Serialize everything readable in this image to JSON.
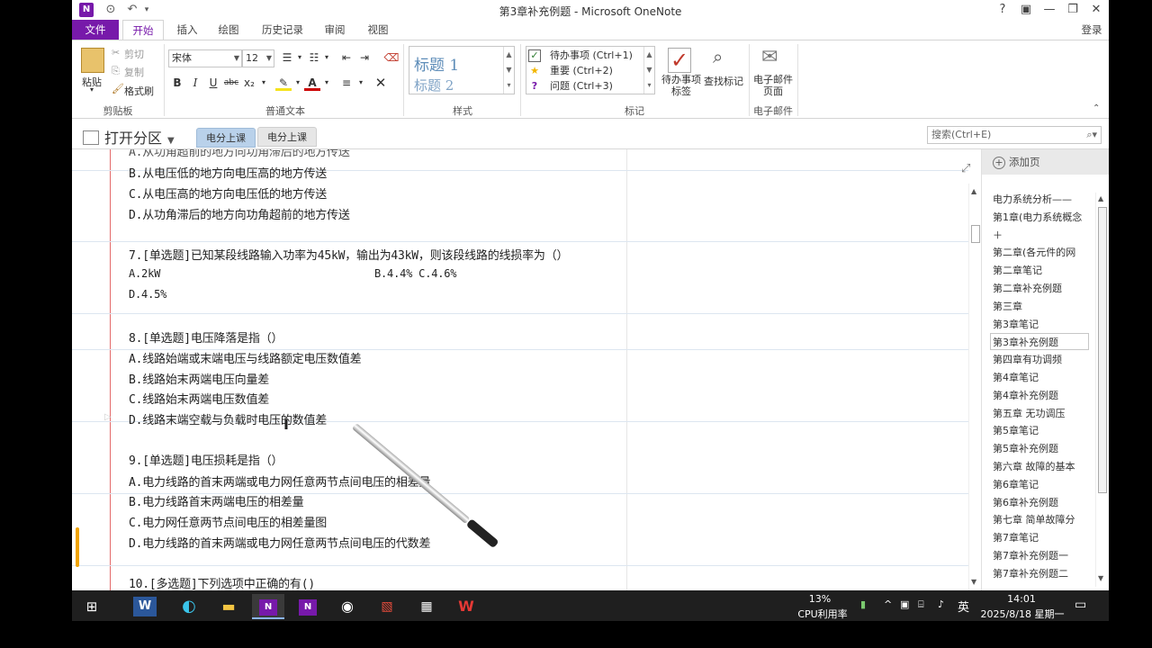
{
  "window": {
    "title": "第3章补充例题 - Microsoft OneNote",
    "help": "?",
    "login": "登录"
  },
  "ribbon_tabs": [
    "文件",
    "开始",
    "插入",
    "绘图",
    "历史记录",
    "审阅",
    "视图"
  ],
  "clipboard": {
    "paste": "粘贴",
    "cut": "剪切",
    "copy": "复制",
    "format_painter": "格式刷",
    "label": "剪贴板"
  },
  "basic_text": {
    "font": "宋体",
    "size": "12",
    "label": "普通文本"
  },
  "styles": {
    "heading1": "标题 1",
    "heading2": "标题 2",
    "label": "样式"
  },
  "tags": {
    "items": [
      {
        "label": "待办事项 (Ctrl+1)",
        "color": "#2e7d32"
      },
      {
        "label": "重要 (Ctrl+2)",
        "color": "#f2b600"
      },
      {
        "label": "问题 (Ctrl+3)",
        "color": "#7719aa"
      }
    ],
    "todo_tag": "待办事项标签",
    "find_tags": "查找标记",
    "label": "标记"
  },
  "email": {
    "button": "电子邮件页面",
    "label": "电子邮件"
  },
  "nav": {
    "notebook": "打开分区",
    "sections": [
      "电分上课",
      "电分上课"
    ],
    "search_placeholder": "搜索(Ctrl+E)"
  },
  "note_lines": [
    "B.从电压低的地方向电压高的地方传送",
    "C.从电压高的地方向电压低的地方传送",
    "D.从功角滞后的地方向功角超前的地方传送",
    "7.[单选题]已知某段线路输入功率为45kW，输出为43kW，则该段线路的线损率为（）",
    "A.2kW",
    "B.4.4% C.4.6%",
    "D.4.5%",
    "8.[单选题]电压降落是指（）",
    "A.线路始端或末端电压与线路额定电压数值差",
    "B.线路始末两端电压向量差",
    "C.线路始末两端电压数值差",
    "D.线路末端空载与负载时电压的数值差",
    "9.[单选题]电压损耗是指（）",
    "A.电力线路的首末两端或电力网任意两节点间电压的相差量",
    "B.电力线路首末两端电压的相差量",
    "C.电力网任意两节点间电压的相差量图",
    "D.电力线路的首末两端或电力网任意两节点间电压的代数差",
    "10.[多选题]下列选项中正确的有()"
  ],
  "pages": {
    "add": "添加页",
    "list": [
      "电力系统分析——",
      "第1章(电力系统概念",
      "＋",
      "第二章(各元件的网",
      "第二章笔记",
      "第二章补充例题",
      "第三章",
      "第3章笔记",
      "第3章补充例题",
      "第四章有功调频",
      "第4章笔记",
      "第4章补充例题",
      "第五章  无功调压",
      "第5章笔记",
      "第5章补充例题",
      "第六章 故障的基本",
      "第6章笔记",
      "第6章补充例题",
      "第七章 简单故障分",
      "第7章笔记",
      "第7章补充例题一",
      "第7章补充例题二"
    ],
    "active_index": 8
  },
  "taskbar": {
    "cpu_percent": "13%",
    "cpu_label": "CPU利用率",
    "ime": "英",
    "time": "14:01",
    "date": "2025/8/18 星期一"
  }
}
